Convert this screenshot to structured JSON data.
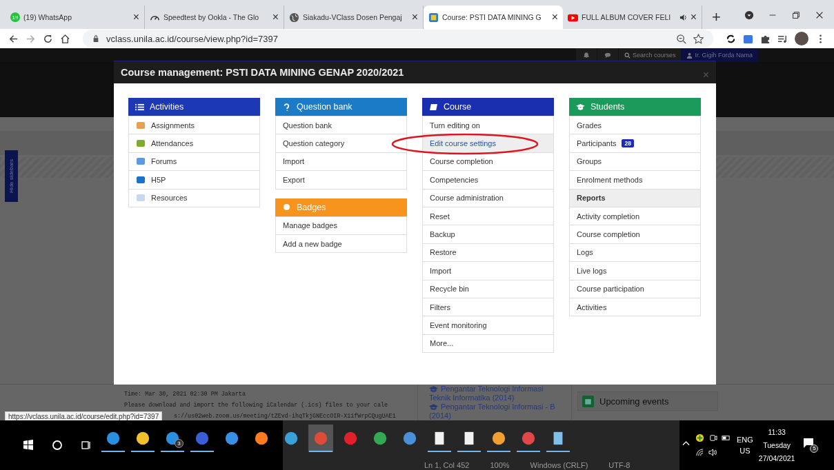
{
  "browser": {
    "tabs": [
      {
        "title": "(19) WhatsApp",
        "badge": "19",
        "selected": false,
        "audio": false
      },
      {
        "title": "Speedtest by Ookla - The Glo",
        "selected": false,
        "audio": false
      },
      {
        "title": "Siakadu-VClass Dosen Pengaj",
        "selected": false,
        "audio": false
      },
      {
        "title": "Course: PSTI DATA MINING G",
        "selected": true,
        "audio": false
      },
      {
        "title": "FULL ALBUM COVER FELI",
        "selected": false,
        "audio": true
      }
    ],
    "close_glyph": "×",
    "new_tab": "+",
    "address": "vclass.unila.ac.id/course/view.php?id=7397"
  },
  "page": {
    "header": {
      "search": "Search courses",
      "user": "Ir. Gigih Forda Nama"
    },
    "hide_sidebars": "Hide sidebars",
    "announcement_lines": [
      "Time: Mar 30, 2021 02:30 PM Jakarta",
      "Please download and import the following iCalendar (.ics) files to your cale",
      "s://us02web.zoom.us/meeting/tZEvd-ihqTkjGNEccOIR-X11fWrpCQugUAE1"
    ],
    "courses": [
      {
        "title": "Pengantar Teknologi Informasi",
        "subtitle": "Teknik Informatika (2014)"
      },
      {
        "title": "Pengantar Teknologi Informasi - B",
        "subtitle": "(2014)"
      }
    ],
    "upcoming_events": "Upcoming events",
    "status_url": "https://vclass.unila.ac.id/course/edit.php?id=7397"
  },
  "modal": {
    "title": "Course management: PSTI DATA MINING GENAP 2020/2021",
    "close": "×",
    "columns": [
      [
        {
          "title": "Activities",
          "color": "#1d38b5",
          "items": [
            {
              "label": "Assignments",
              "kind": "activity"
            },
            {
              "label": "Attendances",
              "kind": "activity"
            },
            {
              "label": "Forums",
              "kind": "activity"
            },
            {
              "label": "H5P",
              "kind": "activity"
            },
            {
              "label": "Resources",
              "kind": "activity"
            }
          ]
        }
      ],
      [
        {
          "title": "Question bank",
          "color": "#1b7bc6",
          "items": [
            {
              "label": "Question bank",
              "kind": "link"
            },
            {
              "label": "Question category",
              "kind": "link"
            },
            {
              "label": "Import",
              "kind": "link"
            },
            {
              "label": "Export",
              "kind": "link"
            }
          ]
        },
        {
          "title": "Badges",
          "color": "#f7941d",
          "items": [
            {
              "label": "Manage badges",
              "kind": "link"
            },
            {
              "label": "Add a new badge",
              "kind": "link"
            }
          ]
        }
      ],
      [
        {
          "title": "Course",
          "color": "#1a2fb0",
          "items": [
            {
              "label": "Turn editing on",
              "kind": "link",
              "hovered": false
            },
            {
              "label": "Edit course settings",
              "kind": "link",
              "hovered": true
            },
            {
              "label": "Course completion",
              "kind": "link",
              "hovered": false
            },
            {
              "label": "Competencies",
              "kind": "link",
              "hovered": false
            },
            {
              "label": "Course administration",
              "kind": "link",
              "hovered": false
            },
            {
              "label": "Reset",
              "kind": "link",
              "hovered": false
            },
            {
              "label": "Backup",
              "kind": "link",
              "hovered": false
            },
            {
              "label": "Restore",
              "kind": "link",
              "hovered": false
            },
            {
              "label": "Import",
              "kind": "link",
              "hovered": false
            },
            {
              "label": "Recycle bin",
              "kind": "link",
              "hovered": false
            },
            {
              "label": "Filters",
              "kind": "link",
              "hovered": false
            },
            {
              "label": "Event monitoring",
              "kind": "link",
              "hovered": false
            },
            {
              "label": "More...",
              "kind": "link",
              "hovered": false
            }
          ]
        }
      ],
      [
        {
          "title": "Students",
          "color": "#1a9b5c",
          "items": [
            {
              "label": "Grades",
              "kind": "link"
            },
            {
              "label": "Participants",
              "kind": "link",
              "badge": "28"
            },
            {
              "label": "Groups",
              "kind": "link"
            },
            {
              "label": "Enrolment methods",
              "kind": "link"
            },
            {
              "label": "Reports",
              "kind": "heading"
            },
            {
              "label": "Activity completion",
              "kind": "link"
            },
            {
              "label": "Course completion",
              "kind": "link"
            },
            {
              "label": "Logs",
              "kind": "link"
            },
            {
              "label": "Live logs",
              "kind": "link"
            },
            {
              "label": "Course participation",
              "kind": "link"
            },
            {
              "label": "Activities",
              "kind": "link"
            }
          ]
        }
      ]
    ]
  },
  "notepad_status": [
    "Ln 1, Col 452",
    "100%",
    "Windows (CRLF)",
    "UTF-8"
  ],
  "taskbar": {
    "apps": [
      {
        "running": true,
        "selected": false
      },
      {
        "running": true,
        "selected": false
      },
      {
        "running": true,
        "selected": false,
        "badge": "3"
      },
      {
        "running": true,
        "selected": false
      },
      {
        "running": false,
        "selected": false
      },
      {
        "running": false,
        "selected": false
      },
      {
        "running": false,
        "selected": false
      },
      {
        "running": true,
        "selected": true
      },
      {
        "running": false,
        "selected": false
      },
      {
        "running": false,
        "selected": false
      },
      {
        "running": false,
        "selected": false
      },
      {
        "running": true,
        "selected": false
      },
      {
        "running": true,
        "selected": false
      },
      {
        "running": true,
        "selected": false
      },
      {
        "running": true,
        "selected": false
      },
      {
        "running": true,
        "selected": false
      }
    ],
    "language": [
      "ENG",
      "US"
    ],
    "time": "11:33",
    "day": "Tuesday",
    "date": "27/04/2021",
    "notifications": "5"
  }
}
